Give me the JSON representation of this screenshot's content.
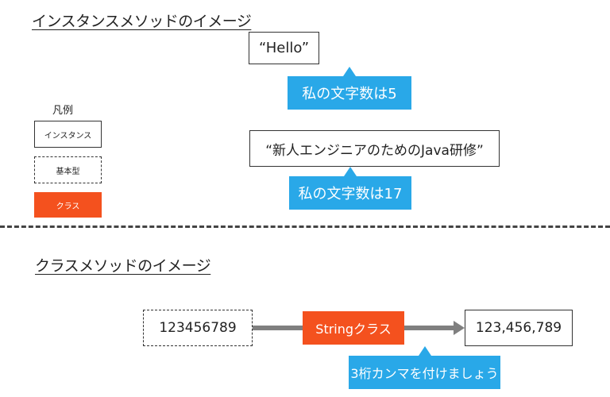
{
  "instance_section": {
    "heading": "インスタンスメソッドのイメージ",
    "example1": {
      "value": "“Hello”",
      "note": "私の文字数は5"
    },
    "example2": {
      "value": "“新人エンジニアのためのJava研修”",
      "note": "私の文字数は17"
    }
  },
  "legend": {
    "title": "凡例",
    "instance": "インスタンス",
    "primitive": "基本型",
    "class": "クラス"
  },
  "class_section": {
    "heading": "クラスメソッドのイメージ",
    "input": "123456789",
    "class_name": "Stringクラス",
    "output": "123,456,789",
    "note": "3桁カンマを付けましょう"
  },
  "colors": {
    "class_orange": "#f4511e",
    "callout_blue": "#29a8e8",
    "arrow_gray": "#7f7f7f"
  }
}
